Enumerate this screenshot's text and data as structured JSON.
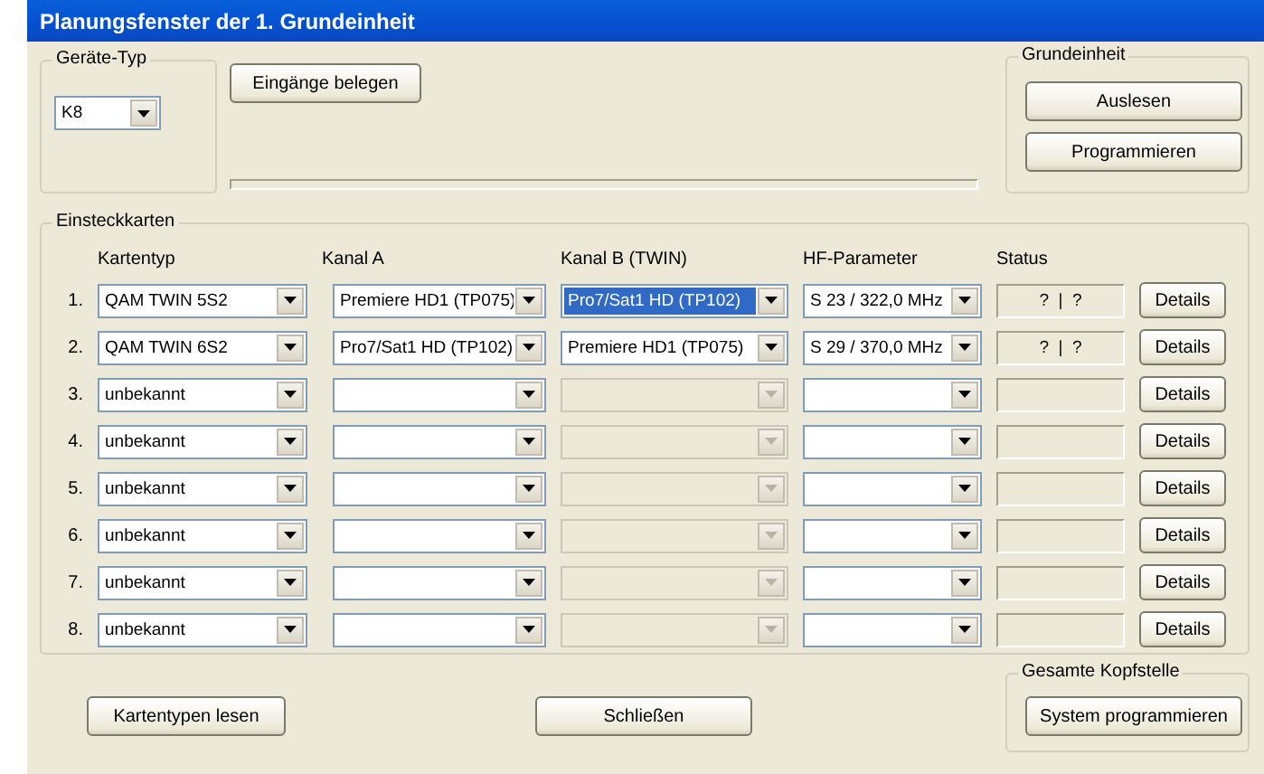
{
  "window": {
    "title": "Planungsfenster der 1. Grundeinheit"
  },
  "device_type": {
    "label": "Geräte-Typ",
    "value": "K8"
  },
  "assign_button": "Eingänge belegen",
  "base_unit": {
    "label": "Grundeinheit",
    "buttons": [
      "Auslesen",
      "Programmieren"
    ]
  },
  "cards": {
    "label": "Einsteckkarten",
    "columns": [
      "Kartentyp",
      "Kanal A",
      "Kanal B (TWIN)",
      "HF-Parameter",
      "Status"
    ],
    "rows": [
      {
        "number": "1.",
        "card_type": "QAM TWIN 5S2",
        "channel_a": "Premiere HD1 (TP075)",
        "channel_b": "Pro7/Sat1 HD (TP102)",
        "channel_b_disabled": false,
        "channel_b_selected": true,
        "hf": "S 23 / 322,0 MHz",
        "status": "?  |  ?",
        "details": "Details"
      },
      {
        "number": "2.",
        "card_type": "QAM TWIN 6S2",
        "channel_a": "Pro7/Sat1 HD (TP102)",
        "channel_b": "Premiere HD1 (TP075)",
        "channel_b_disabled": false,
        "channel_b_selected": false,
        "hf": "S 29 / 370,0 MHz",
        "status": "?  |  ?",
        "details": "Details"
      },
      {
        "number": "3.",
        "card_type": "unbekannt",
        "channel_b_disabled": true,
        "details": "Details"
      },
      {
        "number": "4.",
        "card_type": "unbekannt",
        "channel_b_disabled": true,
        "details": "Details"
      },
      {
        "number": "5.",
        "card_type": "unbekannt",
        "channel_b_disabled": true,
        "details": "Details"
      },
      {
        "number": "6.",
        "card_type": "unbekannt",
        "channel_b_disabled": true,
        "details": "Details"
      },
      {
        "number": "7.",
        "card_type": "unbekannt",
        "channel_b_disabled": true,
        "details": "Details"
      },
      {
        "number": "8.",
        "card_type": "unbekannt",
        "channel_b_disabled": true,
        "details": "Details"
      }
    ]
  },
  "read_types_button": "Kartentypen lesen",
  "close_button": "Schließen",
  "headend": {
    "label": "Gesamte Kopfstelle",
    "button": "System programmieren"
  }
}
